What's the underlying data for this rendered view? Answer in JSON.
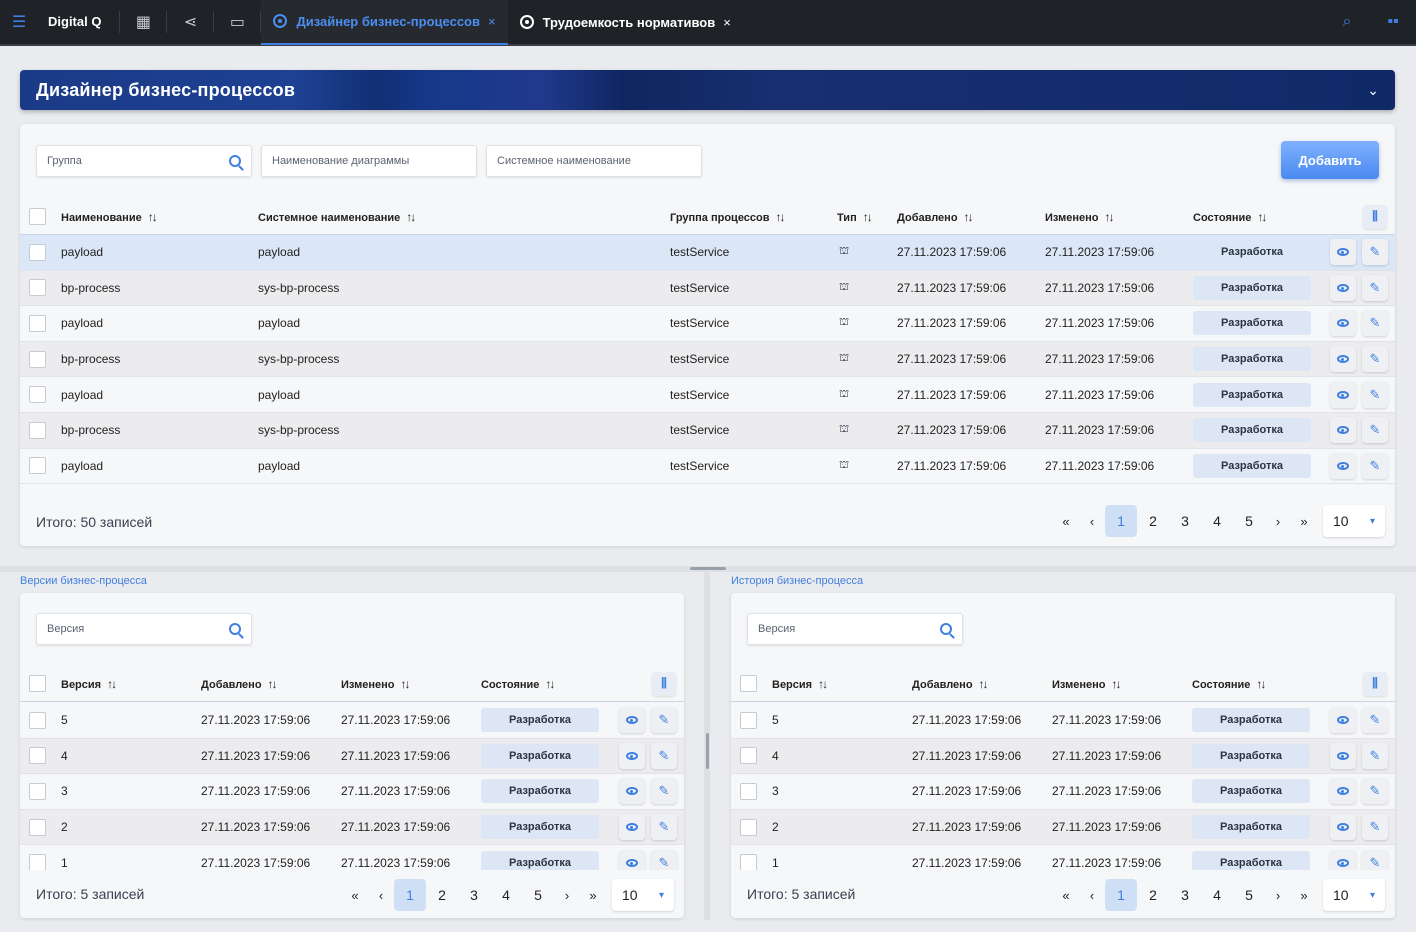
{
  "topbar": {
    "brand": "Digital Q",
    "tabs": [
      {
        "label": "Дизайнер бизнес-процессов",
        "close": "×",
        "active": true
      },
      {
        "label": "Трудоемкость нормативов",
        "close": "×",
        "active": false
      }
    ]
  },
  "banner": {
    "title": "Дизайнер бизнес-процессов"
  },
  "main": {
    "filters": {
      "group_placeholder": "Группа",
      "diagram_placeholder": "Наименование диаграммы",
      "system_placeholder": "Системное наименование"
    },
    "add_label": "Добавить",
    "columns": [
      "Наименование",
      "Системное наименование",
      "Группа процессов",
      "Тип",
      "Добавлено",
      "Изменено",
      "Состояние"
    ],
    "sort_glyph": "↑↓",
    "rows": [
      {
        "name": "payload",
        "system": "payload",
        "group": "testService",
        "added": "27.11.2023 17:59:06",
        "changed": "27.11.2023 17:59:06",
        "state": "Разработка"
      },
      {
        "name": "bp-process",
        "system": "sys-bp-process",
        "group": "testService",
        "added": "27.11.2023 17:59:06",
        "changed": "27.11.2023 17:59:06",
        "state": "Разработка"
      },
      {
        "name": "payload",
        "system": "payload",
        "group": "testService",
        "added": "27.11.2023 17:59:06",
        "changed": "27.11.2023 17:59:06",
        "state": "Разработка"
      },
      {
        "name": "bp-process",
        "system": "sys-bp-process",
        "group": "testService",
        "added": "27.11.2023 17:59:06",
        "changed": "27.11.2023 17:59:06",
        "state": "Разработка"
      },
      {
        "name": "payload",
        "system": "payload",
        "group": "testService",
        "added": "27.11.2023 17:59:06",
        "changed": "27.11.2023 17:59:06",
        "state": "Разработка"
      },
      {
        "name": "bp-process",
        "system": "sys-bp-process",
        "group": "testService",
        "added": "27.11.2023 17:59:06",
        "changed": "27.11.2023 17:59:06",
        "state": "Разработка"
      },
      {
        "name": "payload",
        "system": "payload",
        "group": "testService",
        "added": "27.11.2023 17:59:06",
        "changed": "27.11.2023 17:59:06",
        "state": "Разработка"
      }
    ],
    "total": "Итого: 50 записей",
    "pages": [
      "1",
      "2",
      "3",
      "4",
      "5"
    ],
    "per_page": "10"
  },
  "pager_nav": {
    "first": "«",
    "prev": "‹",
    "next": "›",
    "last": "»"
  },
  "versions": {
    "title": "Версии бизнес-процесса",
    "placeholder": "Версия",
    "columns": [
      "Версия",
      "Добавлено",
      "Изменено",
      "Состояние"
    ],
    "rows": [
      {
        "version": "5",
        "added": "27.11.2023 17:59:06",
        "changed": "27.11.2023 17:59:06",
        "state": "Разработка"
      },
      {
        "version": "4",
        "added": "27.11.2023 17:59:06",
        "changed": "27.11.2023 17:59:06",
        "state": "Разработка"
      },
      {
        "version": "3",
        "added": "27.11.2023 17:59:06",
        "changed": "27.11.2023 17:59:06",
        "state": "Разработка"
      },
      {
        "version": "2",
        "added": "27.11.2023 17:59:06",
        "changed": "27.11.2023 17:59:06",
        "state": "Разработка"
      },
      {
        "version": "1",
        "added": "27.11.2023 17:59:06",
        "changed": "27.11.2023 17:59:06",
        "state": "Разработка"
      }
    ],
    "total": "Итого: 5 записей",
    "pages": [
      "1",
      "2",
      "3",
      "4",
      "5"
    ],
    "per_page": "10"
  },
  "history": {
    "title": "История бизнес-процесса",
    "placeholder": "Версия",
    "columns": [
      "Версия",
      "Добавлено",
      "Изменено",
      "Состояние"
    ],
    "rows": [
      {
        "version": "5",
        "added": "27.11.2023 17:59:06",
        "changed": "27.11.2023 17:59:06",
        "state": "Разработка"
      },
      {
        "version": "4",
        "added": "27.11.2023 17:59:06",
        "changed": "27.11.2023 17:59:06",
        "state": "Разработка"
      },
      {
        "version": "3",
        "added": "27.11.2023 17:59:06",
        "changed": "27.11.2023 17:59:06",
        "state": "Разработка"
      },
      {
        "version": "2",
        "added": "27.11.2023 17:59:06",
        "changed": "27.11.2023 17:59:06",
        "state": "Разработка"
      },
      {
        "version": "1",
        "added": "27.11.2023 17:59:06",
        "changed": "27.11.2023 17:59:06",
        "state": "Разработка"
      }
    ],
    "total": "Итого: 5 записей",
    "pages": [
      "1",
      "2",
      "3",
      "4",
      "5"
    ],
    "per_page": "10"
  },
  "colors": {
    "accent": "#3f7fe0",
    "topbar": "#1f2226",
    "badge": "#dde6f5"
  },
  "icons": [
    "menu-icon",
    "layout-icon",
    "share-icon",
    "monitor-icon",
    "process-tab-icon",
    "search-icon",
    "apps-grid-icon",
    "sort-icon",
    "hierarchy-icon",
    "eye-icon",
    "edit-icon",
    "columns-icon",
    "chevron-down-icon"
  ]
}
